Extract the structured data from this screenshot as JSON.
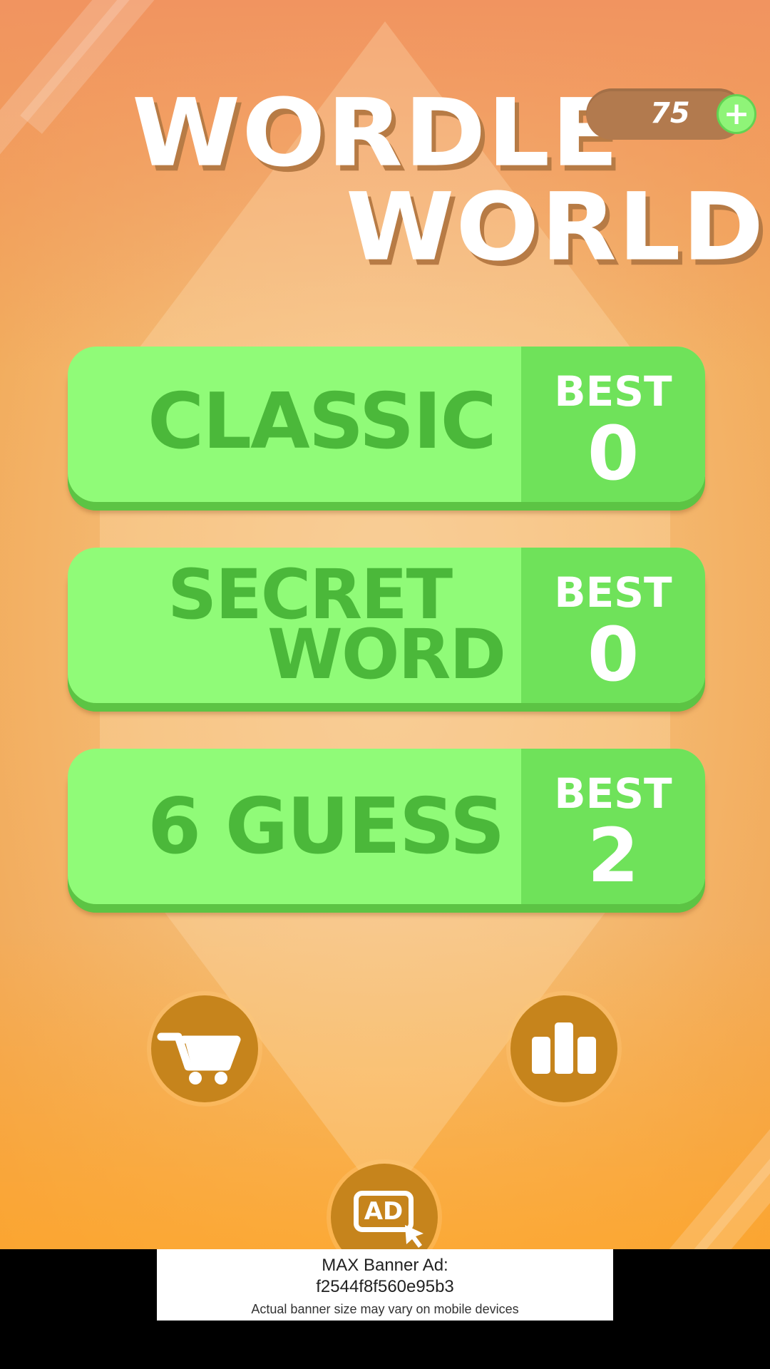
{
  "title": {
    "line1": "WORDLE",
    "line2": "WORLD"
  },
  "coins": {
    "count": "75",
    "add_icon": "plus-icon"
  },
  "modes": [
    {
      "label_line1": "CLASSIC",
      "label_line2": "",
      "best_label": "BEST",
      "best_value": "0"
    },
    {
      "label_line1": "SECRET",
      "label_line2": "WORD",
      "best_label": "BEST",
      "best_value": "0"
    },
    {
      "label_line1": "6 GUESS",
      "label_line2": "",
      "best_label": "BEST",
      "best_value": "2"
    }
  ],
  "actions": {
    "shop_icon": "cart-icon",
    "stats_icon": "bar-chart-icon",
    "ad_icon": "ad-icon",
    "ad_icon_text": "AD"
  },
  "banner": {
    "title_line1": "MAX Banner Ad:",
    "title_line2": "f2544f8f560e95b3",
    "subtitle": "Actual banner size may vary on mobile devices"
  },
  "colors": {
    "button_green": "#90fb78",
    "button_text": "#4bb83a",
    "round_button": "#c6841c",
    "background": "#f4b366"
  }
}
